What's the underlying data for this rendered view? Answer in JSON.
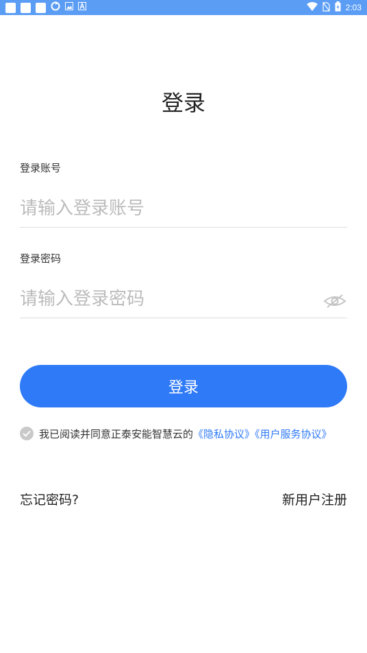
{
  "status_bar": {
    "time": "2:03",
    "notification_icons": [
      "app-icon",
      "app-icon",
      "app-icon",
      "sync-icon",
      "image-icon",
      "text-a-icon"
    ],
    "system_icons": [
      "wifi-icon",
      "no-sim-icon",
      "battery-charging-icon"
    ]
  },
  "page": {
    "title": "登录"
  },
  "form": {
    "account": {
      "label": "登录账号",
      "value": "",
      "placeholder": "请输入登录账号"
    },
    "password": {
      "label": "登录密码",
      "value": "",
      "placeholder": "请输入登录密码",
      "toggle_icon": "eye-hidden-icon"
    },
    "submit_label": "登录"
  },
  "agreement": {
    "checked": true,
    "text": "我已阅读并同意正泰安能智慧云的",
    "privacy_link": "《隐私协议》",
    "service_link": "《用户服务协议》"
  },
  "footer": {
    "forgot_password": "忘记密码?",
    "register": "新用户注册"
  },
  "colors": {
    "status_bar": "#5b9df5",
    "primary": "#2f7af7",
    "placeholder": "#bbbbbb",
    "divider": "#dddddd"
  }
}
